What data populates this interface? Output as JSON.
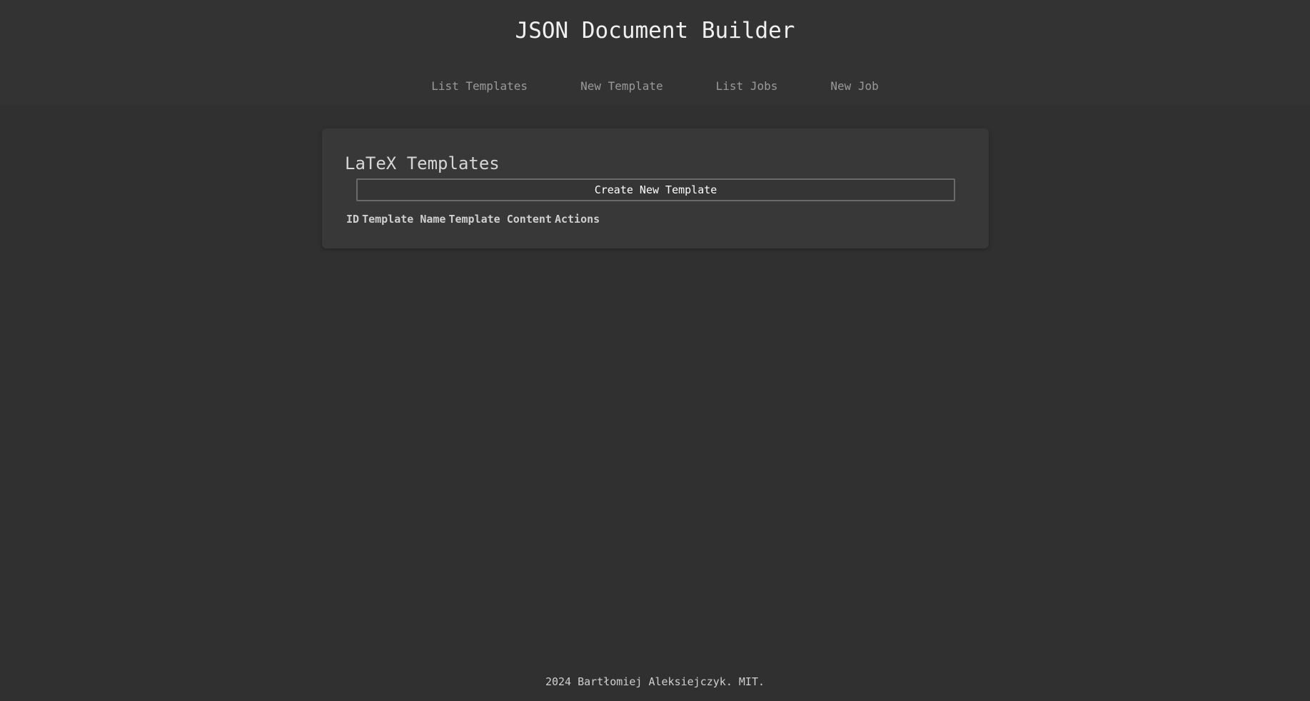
{
  "header": {
    "title": "JSON Document Builder",
    "nav": [
      {
        "label": "List Templates"
      },
      {
        "label": "New Template"
      },
      {
        "label": "List Jobs"
      },
      {
        "label": "New Job"
      }
    ]
  },
  "main": {
    "title": "LaTeX Templates",
    "create_label": "Create New Template",
    "table": {
      "columns": [
        "ID",
        "Template Name",
        "Template Content",
        "Actions"
      ],
      "rows": []
    }
  },
  "footer": {
    "text": "2024 Bartłomiej Aleksiejczyk. MIT."
  },
  "colors": {
    "background": "#303030",
    "header_background": "#333333",
    "card_background": "#383838",
    "nav_text": "#9a9a9a",
    "button_border": "#6a6a6a"
  }
}
